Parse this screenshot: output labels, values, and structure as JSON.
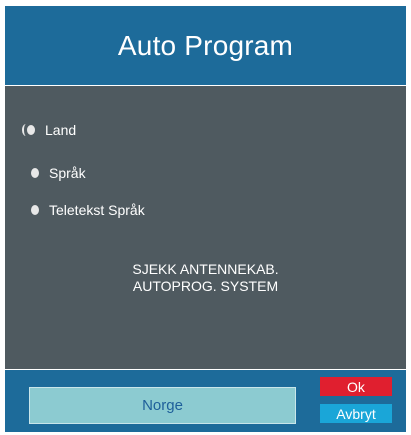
{
  "dialog": {
    "title": "Auto Program"
  },
  "options": [
    {
      "label": "Land",
      "selected": true
    },
    {
      "label": "Språk",
      "selected": false
    },
    {
      "label": "Teletekst Språk",
      "selected": false
    }
  ],
  "message": {
    "line1": "SJEKK ANTENNEKAB.",
    "line2": "AUTOPROG. SYSTEM"
  },
  "footer": {
    "selected_value": "Norge",
    "ok_label": "Ok",
    "cancel_label": "Avbryt"
  },
  "colors": {
    "title_bar": "#1d6b9a",
    "panel": "#4f5a60",
    "ok_button": "#e01f2f",
    "cancel_button": "#1aa6d8",
    "selector": "#8ccbd1"
  }
}
